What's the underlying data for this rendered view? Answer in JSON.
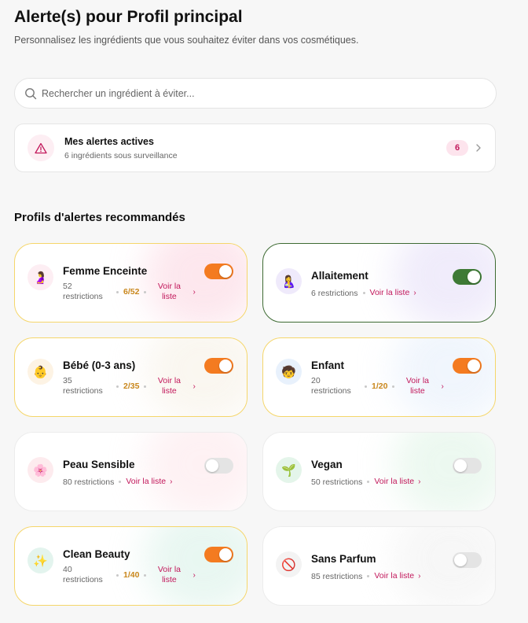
{
  "header": {
    "title": "Alerte(s) pour Profil principal",
    "subtitle": "Personnalisez les ingrédients que vous souhaitez éviter dans vos cosmétiques."
  },
  "search": {
    "placeholder": "Rechercher un ingrédient à éviter...",
    "icon": "search-icon"
  },
  "active_alerts": {
    "title": "Mes alertes actives",
    "subtitle": "6 ingrédients sous surveillance",
    "count": "6",
    "icon": "warning-icon"
  },
  "section_title": "Profils d'alertes recommandés",
  "colors": {
    "accent_orange": "#f47b20",
    "accent_green": "#3e7a35",
    "link_pink": "#c2185b",
    "ratio_amber": "#c9871c"
  },
  "profiles": [
    {
      "name": "Femme Enceinte",
      "restrictions_line1": "52",
      "restrictions_line2": "restrictions",
      "ratio": "6/52",
      "link_line1": "Voir la",
      "link_line2": "liste",
      "enabled": true,
      "emoji": "🤰",
      "icon": "pregnant-woman-icon"
    },
    {
      "name": "Allaitement",
      "restrictions": "6 restrictions",
      "link": "Voir la liste",
      "enabled": true,
      "emoji": "🤱",
      "icon": "breastfeeding-icon"
    },
    {
      "name": "Bébé (0-3 ans)",
      "restrictions_line1": "35",
      "restrictions_line2": "restrictions",
      "ratio": "2/35",
      "link_line1": "Voir la",
      "link_line2": "liste",
      "enabled": true,
      "emoji": "👶",
      "icon": "baby-icon"
    },
    {
      "name": "Enfant",
      "restrictions_line1": "20",
      "restrictions_line2": "restrictions",
      "ratio": "1/20",
      "link_line1": "Voir la",
      "link_line2": "liste",
      "enabled": true,
      "emoji": "🧒",
      "icon": "child-icon"
    },
    {
      "name": "Peau Sensible",
      "restrictions": "80 restrictions",
      "link": "Voir la liste",
      "enabled": false,
      "emoji": "🌸",
      "icon": "flower-icon"
    },
    {
      "name": "Vegan",
      "restrictions": "50 restrictions",
      "link": "Voir la liste",
      "enabled": false,
      "emoji": "🌱",
      "icon": "seedling-icon"
    },
    {
      "name": "Clean Beauty",
      "restrictions_line1": "40",
      "restrictions_line2": "restrictions",
      "ratio": "1/40",
      "link_line1": "Voir la",
      "link_line2": "liste",
      "enabled": true,
      "emoji": "✨",
      "icon": "sparkles-icon"
    },
    {
      "name": "Sans Parfum",
      "restrictions": "85 restrictions",
      "link": "Voir la liste",
      "enabled": false,
      "emoji": "🚫",
      "icon": "no-entry-icon"
    }
  ]
}
